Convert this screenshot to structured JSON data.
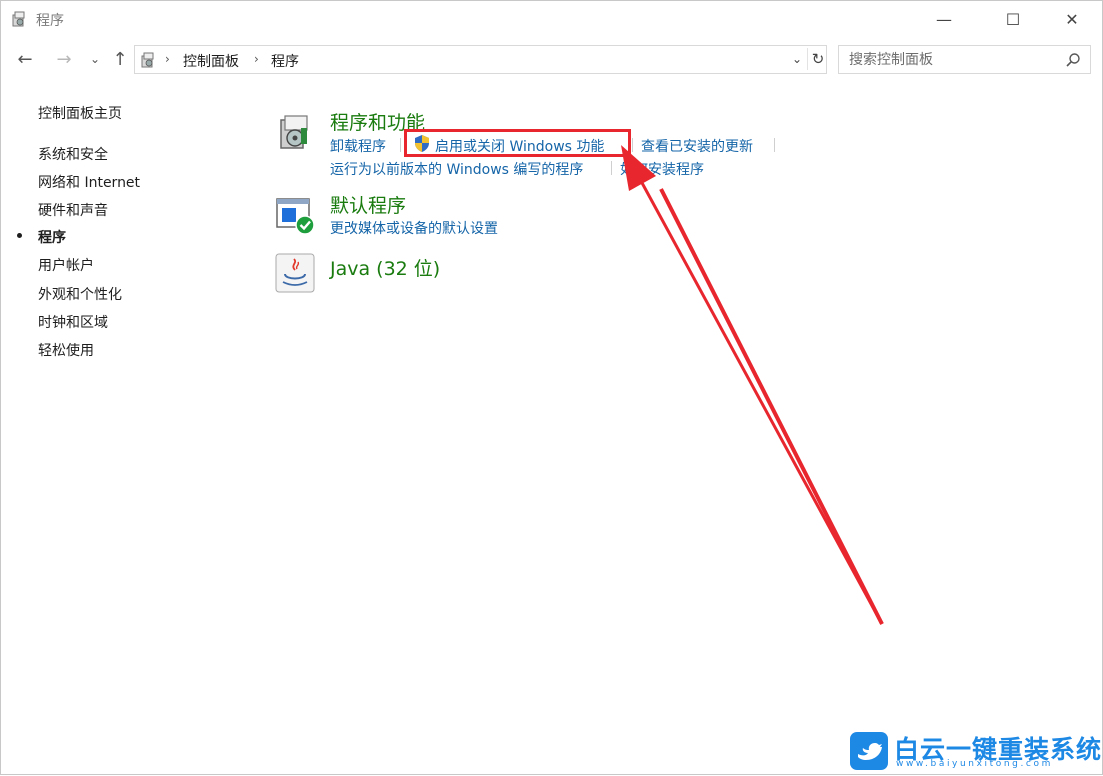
{
  "window": {
    "title": "程序",
    "controls": {
      "minimize": "—",
      "maximize": "☐",
      "close": "✕"
    }
  },
  "nav": {
    "back": "←",
    "forward": "→",
    "recent": "⌄",
    "up": "↑",
    "breadcrumb": [
      "控制面板",
      "程序"
    ],
    "refresh": "↻",
    "dropdown": "⌄"
  },
  "search": {
    "placeholder": "搜索控制面板"
  },
  "sidebar": {
    "items": [
      {
        "label": "控制面板主页"
      },
      {
        "label": "系统和安全"
      },
      {
        "label": "网络和 Internet"
      },
      {
        "label": "硬件和声音"
      },
      {
        "label": "程序",
        "active": true
      },
      {
        "label": "用户帐户"
      },
      {
        "label": "外观和个性化"
      },
      {
        "label": "时钟和区域"
      },
      {
        "label": "轻松使用"
      }
    ]
  },
  "content": {
    "programs_features": {
      "title": "程序和功能",
      "links": {
        "uninstall": "卸载程序",
        "windows_features": "启用或关闭 Windows 功能",
        "view_updates": "查看已安装的更新",
        "run_old": "运行为以前版本的 Windows 编写的程序",
        "how_install": "如何安装程序"
      }
    },
    "default_programs": {
      "title": "默认程序",
      "links": {
        "media_defaults": "更改媒体或设备的默认设置"
      }
    },
    "java": {
      "title": "Java (32 位)"
    }
  },
  "watermark": {
    "text": "白云一键重装系统",
    "sub": "www.baiyunxitong.com"
  },
  "colors": {
    "link": "#1565a8",
    "category_title": "#1a7b0f",
    "annotation": "#e8262e",
    "watermark": "#1e88e5"
  }
}
